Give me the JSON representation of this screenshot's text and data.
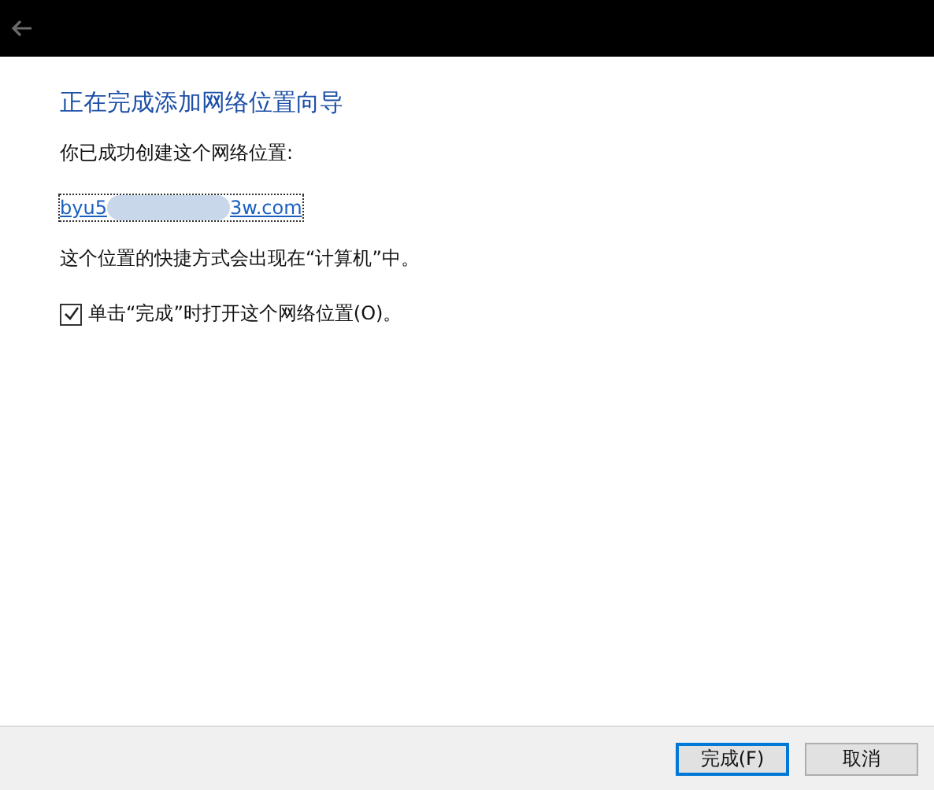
{
  "title": "正在完成添加网络位置向导",
  "intro": "你已成功创建这个网络位置:",
  "link": {
    "start": "byu5",
    "end": "3w.com"
  },
  "note": "这个位置的快捷方式会出现在“计算机”中。",
  "open_option": {
    "label": "单击“完成”时打开这个网络位置(O)。",
    "checked": true
  },
  "buttons": [
    {
      "label": "完成(F)",
      "default": true
    },
    {
      "label": "取消",
      "default": false
    }
  ]
}
